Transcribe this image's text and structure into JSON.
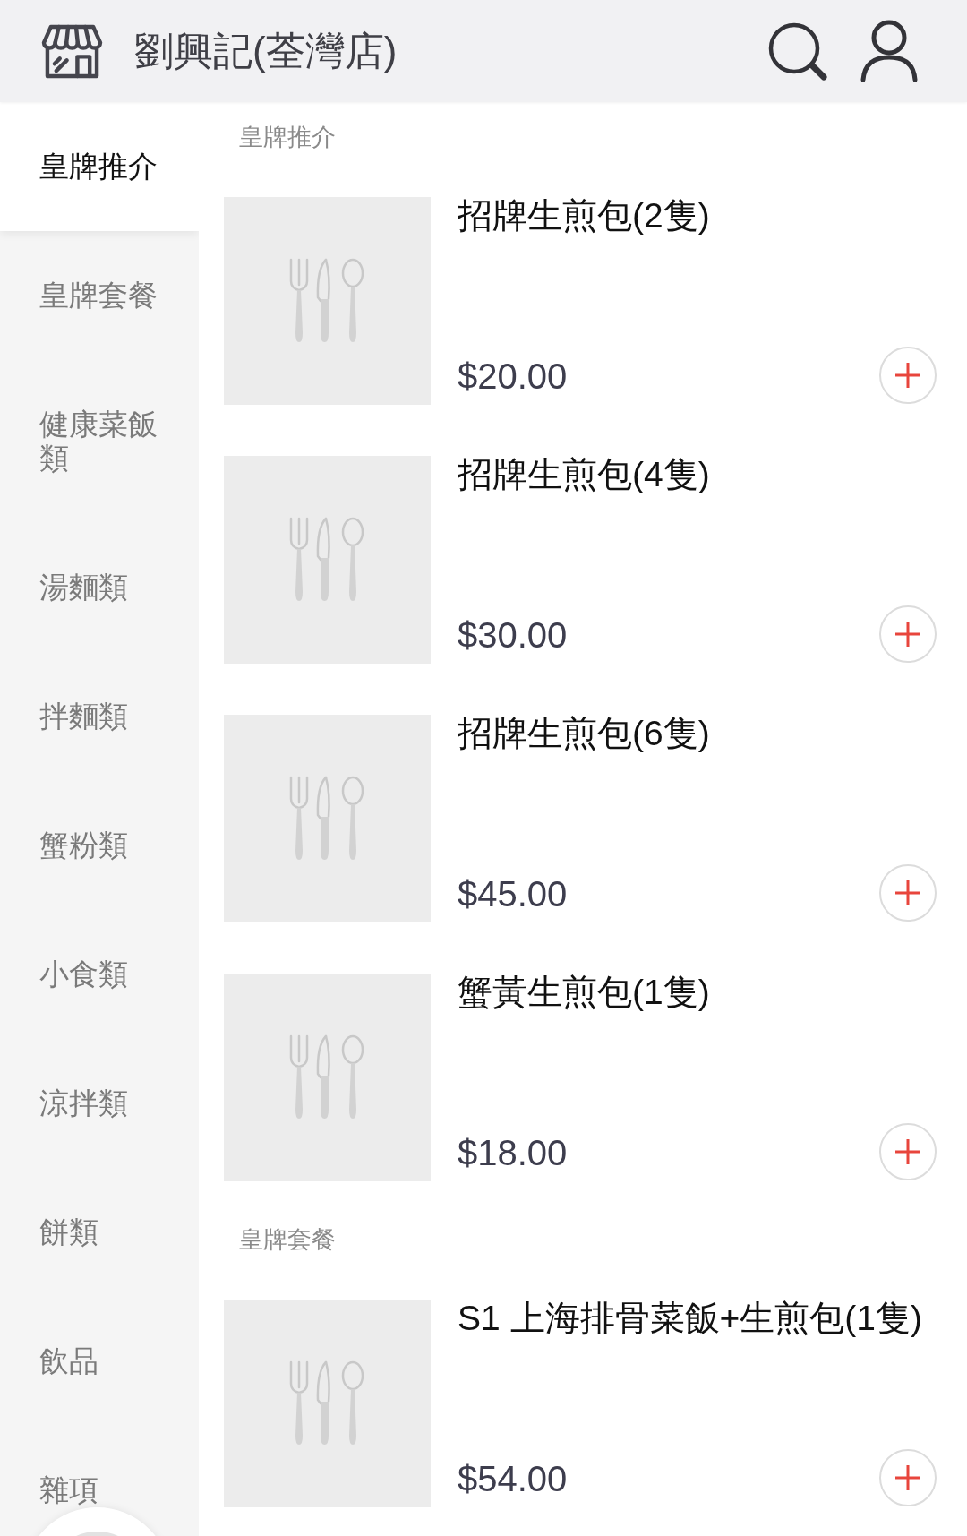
{
  "header": {
    "store_name": "劉興記(荃灣店)"
  },
  "sidebar": {
    "items": [
      {
        "label": "皇牌推介",
        "selected": true
      },
      {
        "label": "皇牌套餐",
        "selected": false
      },
      {
        "label": "健康菜飯類",
        "selected": false
      },
      {
        "label": "湯麵類",
        "selected": false
      },
      {
        "label": "拌麵類",
        "selected": false
      },
      {
        "label": "蟹粉類",
        "selected": false
      },
      {
        "label": "小食類",
        "selected": false
      },
      {
        "label": "涼拌類",
        "selected": false
      },
      {
        "label": "餅類",
        "selected": false
      },
      {
        "label": "飲品",
        "selected": false
      },
      {
        "label": "雜項",
        "selected": false
      }
    ]
  },
  "sections": [
    {
      "title": "皇牌推介",
      "products": [
        {
          "name": "招牌生煎包(2隻)",
          "price": "$20.00"
        },
        {
          "name": "招牌生煎包(4隻)",
          "price": "$30.00"
        },
        {
          "name": "招牌生煎包(6隻)",
          "price": "$45.00"
        },
        {
          "name": "蟹黃生煎包(1隻)",
          "price": "$18.00"
        }
      ]
    },
    {
      "title": "皇牌套餐",
      "products": [
        {
          "name": "S1 上海排骨菜飯+生煎包(1隻)",
          "price": "$54.00"
        }
      ]
    }
  ]
}
